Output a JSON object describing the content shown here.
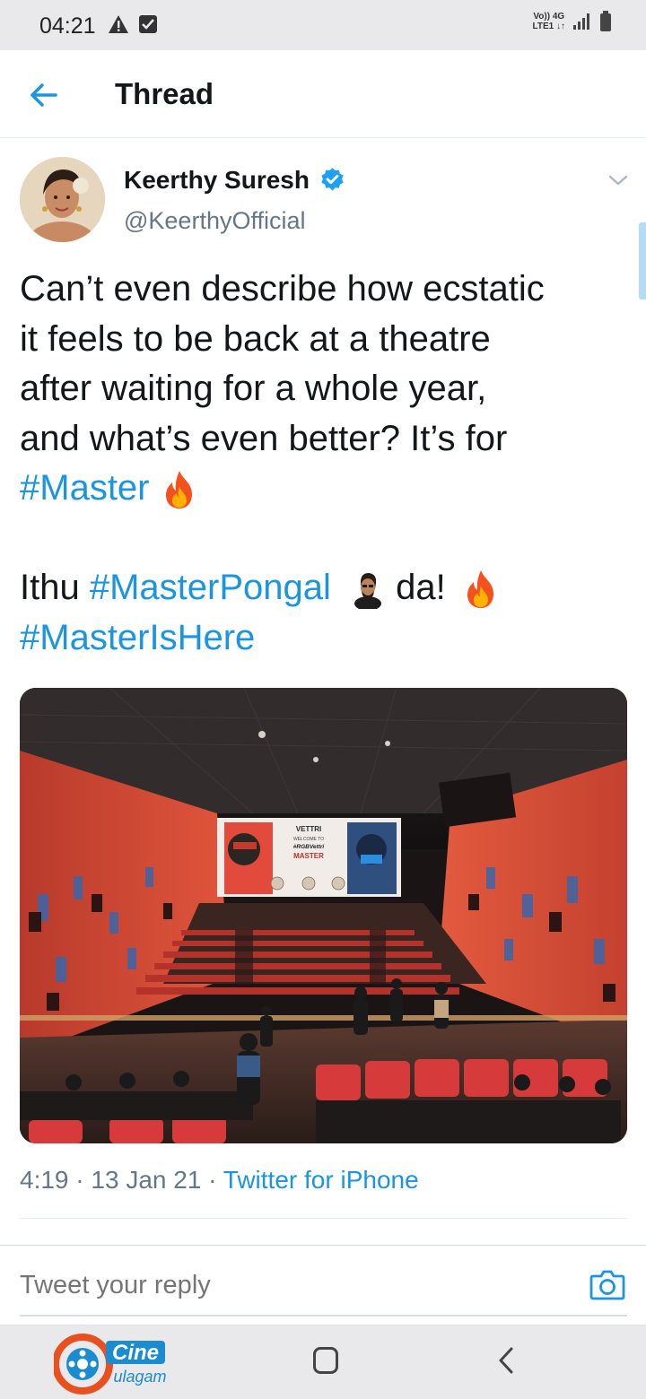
{
  "status_bar": {
    "time": "04:21",
    "network_top": "Vo)) 4G",
    "network_bottom": "LTE1 ↓↑"
  },
  "header": {
    "title": "Thread",
    "back_icon": "arrow-left-icon"
  },
  "tweet": {
    "author_name": "Keerthy Suresh",
    "verified": true,
    "handle": "@KeerthyOfficial",
    "text_line1": "Can’t even describe how ecstatic",
    "text_line2": "it feels to be back at a theatre",
    "text_line3": "after waiting for a whole year,",
    "text_line4": "and what’s even better? It’s for",
    "hashtag_master": "#Master",
    "line6_start": "Ithu ",
    "hashtag_masterpongal": "#MasterPongal",
    "line6_end": " da!",
    "hashtag_masterishere": "#MasterIsHere",
    "image": {
      "screen_brand": "VETTRI",
      "screen_welcome": "WELCOME TO",
      "screen_tag": "#RGBVettri",
      "screen_movie": "MASTER"
    },
    "time": "4:19",
    "date": "13 Jan 21",
    "separator": " · ",
    "source": "Twitter for iPhone"
  },
  "reply": {
    "placeholder": "Tweet your reply"
  },
  "watermark": {
    "line1": "Cine",
    "line2": "ulagam"
  },
  "colors": {
    "link": "#1b95e0",
    "secondary_text": "#657786",
    "primary_text": "#14171a"
  }
}
